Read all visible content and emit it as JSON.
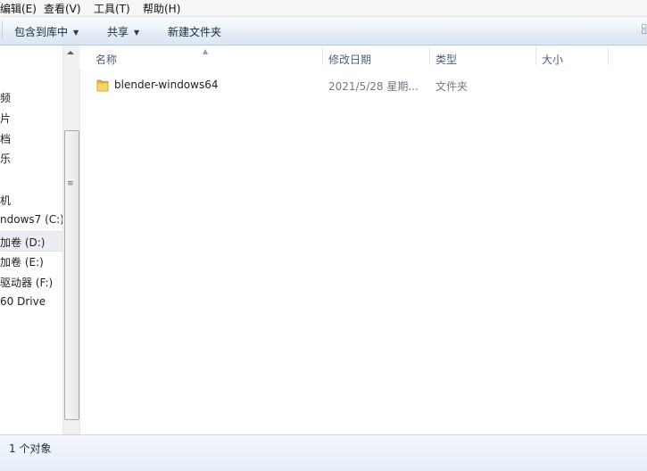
{
  "menubar": {
    "items": [
      "编辑(E)",
      "查看(V)",
      "工具(T)",
      "帮助(H)"
    ]
  },
  "toolbar": {
    "include_library": "包含到库中",
    "share": "共享",
    "new_folder": "新建文件夹"
  },
  "navpane": {
    "items": [
      "频",
      "片",
      "档",
      "乐",
      "机",
      "ndows7 (C:)",
      "加卷 (D:)",
      "加卷 (E:)",
      "驱动器 (F:)",
      "60 Drive"
    ],
    "selected_index": 6
  },
  "columns": {
    "name": "名称",
    "date": "修改日期",
    "type": "类型",
    "size": "大小"
  },
  "files": [
    {
      "name": "blender-windows64",
      "date": "2021/5/28 星期...",
      "type": "文件夹",
      "size": ""
    }
  ],
  "status": {
    "count": "1 个对象"
  },
  "colors": {
    "toolbar_top": "#f9fbfe",
    "toolbar_bottom": "#dde7f3",
    "header_text": "#4c607a",
    "folder": "#e7b93a"
  },
  "icons": {
    "folder": "folder-icon",
    "caret": "chevron-down-icon",
    "sort": "sort-arrow-icon"
  }
}
